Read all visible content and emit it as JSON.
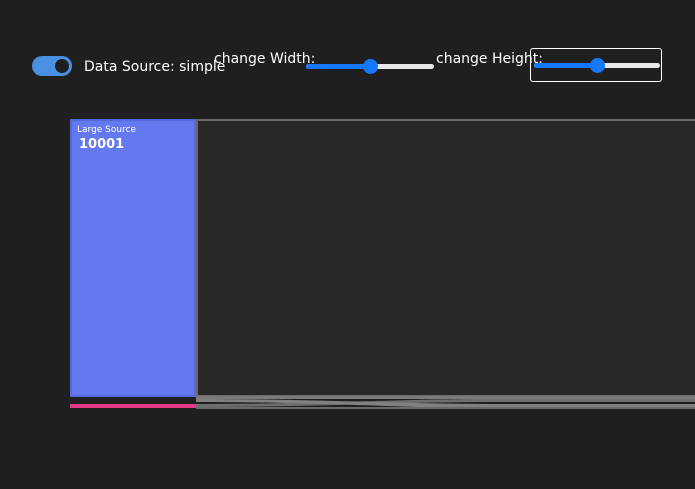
{
  "controls": {
    "source_toggle": {
      "on": true
    },
    "source_label": "Data Source: simple",
    "width_label": "change Width:",
    "height_label": "change Height:",
    "width_slider_value": 0.5,
    "height_slider_value": 0.5
  },
  "chart": {
    "source_node": {
      "name": "Large Source",
      "value": "10001",
      "color": "#6479f0"
    },
    "target_node_color": "#282828",
    "flow_colors": [
      "#e8388a",
      "#888888"
    ]
  }
}
